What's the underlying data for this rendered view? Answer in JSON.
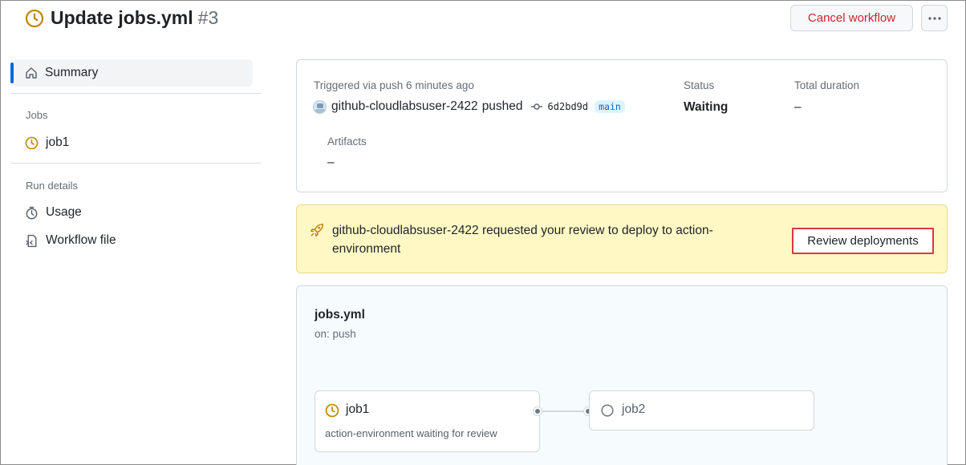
{
  "header": {
    "title": "Update jobs.yml",
    "run_number": "#3",
    "cancel_label": "Cancel workflow",
    "more_icon": "kebab-horizontal-icon"
  },
  "sidebar": {
    "summary_label": "Summary",
    "jobs_heading": "Jobs",
    "jobs": [
      {
        "label": "job1",
        "status": "waiting"
      }
    ],
    "run_details_heading": "Run details",
    "details": [
      {
        "label": "Usage",
        "icon": "stopwatch-icon"
      },
      {
        "label": "Workflow file",
        "icon": "file-code-icon"
      }
    ]
  },
  "summary": {
    "trigger_text": "Triggered via push 6 minutes ago",
    "actor": "github-cloudlabsuser-2422",
    "action": "pushed",
    "commit_sha": "6d2bd9d",
    "branch": "main",
    "status_label": "Status",
    "status_value": "Waiting",
    "duration_label": "Total duration",
    "duration_value": "–",
    "artifacts_label": "Artifacts",
    "artifacts_value": "–"
  },
  "review": {
    "message": "github-cloudlabsuser-2422 requested your review to deploy to action-environment",
    "button_label": "Review deployments"
  },
  "graph": {
    "workflow_name": "jobs.yml",
    "trigger": "on: push",
    "jobs": [
      {
        "name": "job1",
        "subtitle": "action-environment waiting for review",
        "status": "waiting"
      },
      {
        "name": "job2",
        "status": "pending"
      }
    ]
  },
  "colors": {
    "waiting": "#bf8700",
    "accent": "#0969da",
    "danger": "#cf222e",
    "review_bg": "#fff8c5",
    "highlight_border": "#d9393e"
  }
}
